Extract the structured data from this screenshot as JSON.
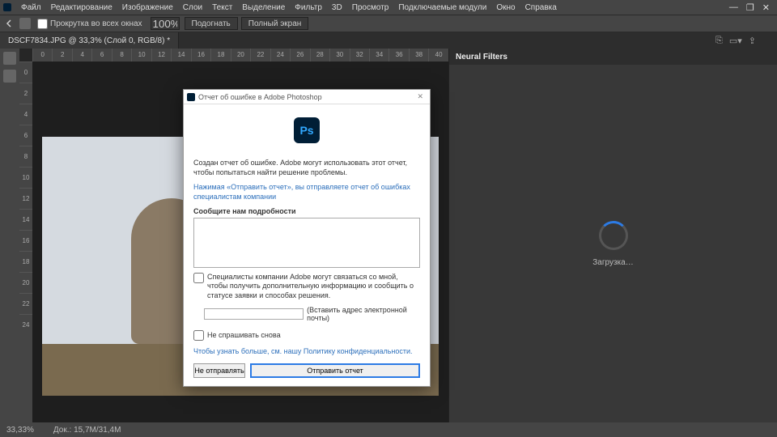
{
  "menu": [
    "Файл",
    "Редактирование",
    "Изображение",
    "Слои",
    "Текст",
    "Выделение",
    "Фильтр",
    "3D",
    "Просмотр",
    "Подключаемые модули",
    "Окно",
    "Справка"
  ],
  "options": {
    "scroll_all": "Прокрутка во всех окнах",
    "zoom_value": "100%",
    "fit": "Подогнать",
    "fullscreen": "Полный экран"
  },
  "tab_title": "DSCF7834.JPG @ 33,3% (Слой 0, RGB/8) *",
  "ruler_h": [
    "0",
    "2",
    "4",
    "6",
    "8",
    "10",
    "12",
    "14",
    "16",
    "18",
    "20",
    "22",
    "24",
    "26",
    "28",
    "30",
    "32",
    "34",
    "36",
    "38",
    "40"
  ],
  "ruler_v": [
    "0",
    "2",
    "4",
    "6",
    "8",
    "10",
    "12",
    "14",
    "16",
    "18",
    "20",
    "22",
    "24"
  ],
  "right_panel": {
    "title": "Neural Filters",
    "loading": "Загрузка…"
  },
  "status": {
    "zoom": "33,33%",
    "doc": "Док.: 15,7М/31,4М"
  },
  "dialog": {
    "title": "Отчет об ошибке в Adobe Photoshop",
    "icon_text": "Ps",
    "para1": "Создан отчет об ошибке. Adobe могут использовать этот отчет, чтобы попытаться найти решение проблемы.",
    "para2a": "Нажимая «Отправить отчет», вы отправляете отчет об ошибках специалистам компании",
    "details_label": "Сообщите нам подробности",
    "contact_text": "Специалисты компании Adobe могут связаться со мной, чтобы получить дополнительную информацию и сообщить о статусе заявки и способах решения.",
    "email_hint": "(Вставить адрес электронной почты)",
    "dont_ask": "Не спрашивать снова",
    "policy": "Чтобы узнать больше, см. нашу Политику конфиденциальности.",
    "btn_no": "Не отправлять",
    "btn_send": "Отправить отчет"
  }
}
